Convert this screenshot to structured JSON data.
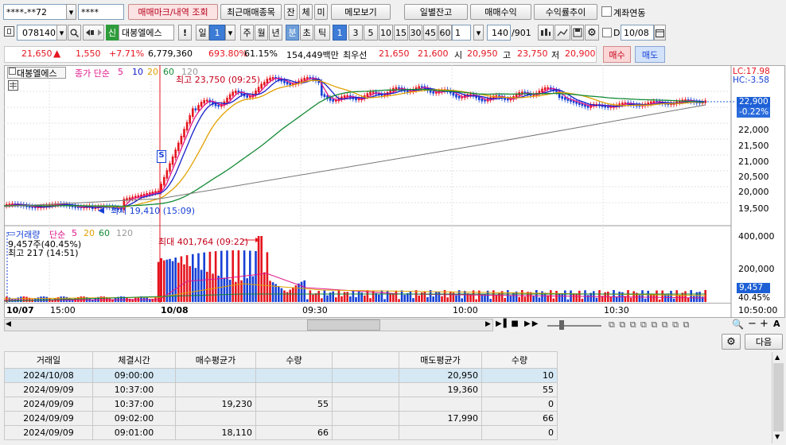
{
  "toolbar1": {
    "account": "****-**72",
    "password": "****",
    "btn_markview": "매매마크/내역 조회",
    "btn_recent": "최근매매종목",
    "btn_jan": "잔",
    "btn_che": "체",
    "btn_mi": "미",
    "btn_memo": "메모보기",
    "btn_daily": "일별잔고",
    "btn_profit": "매매수익",
    "btn_rate": "수익률추이",
    "chk_link": "계좌연동"
  },
  "toolbar2": {
    "code": "078140",
    "sin": "신",
    "stock_name": "대봉엘에스",
    "excl": "!",
    "period_il": "일",
    "period_num": "1",
    "p_ju": "주",
    "p_wol": "월",
    "p_nyeon": "년",
    "p_bun": "분",
    "p_cho": "초",
    "p_tik": "틱",
    "intervals": [
      "1",
      "3",
      "5",
      "10",
      "15",
      "30",
      "45",
      "60"
    ],
    "interval_sel": "1",
    "count": "140",
    "total": "/901",
    "d_label": "D",
    "date": "10/08"
  },
  "quote": {
    "price": "21,650",
    "arrow": "▲",
    "change": "1,550",
    "rate": "+7.71%",
    "volume": "6,779,360",
    "vol_rate": "693.80%",
    "turnover": "61.15%",
    "amount": "154,449백만",
    "best_label": "최우선",
    "best_ask": "21,650",
    "best_bid": "21,600",
    "open_label": "시",
    "open": "20,950",
    "high_label": "고",
    "high": "23,750",
    "low_label": "저",
    "low": "20,900",
    "buy": "매수",
    "sell": "매도"
  },
  "price_chart": {
    "name": "대봉엘에스",
    "ma_label": "종가 단순",
    "ma_periods": [
      "5",
      "10",
      "20",
      "60",
      "120"
    ],
    "ma_colors": [
      "#e0178a",
      "#1520c8",
      "#e2a100",
      "#138a35",
      "#777777"
    ],
    "high_marker": "최고 23,750 (09:25)",
    "low_marker": "최저 19,410 (15:09)",
    "lc": "LC:17.98",
    "hc": "HC:-3.58",
    "cur_price": "22,900",
    "cur_rate": "-0.22%",
    "y_ticks": [
      "22,000",
      "21,500",
      "21,000",
      "20,500",
      "20,000",
      "19,500"
    ],
    "s_badge": "S"
  },
  "volume_chart": {
    "name": "거래량",
    "ma_label": "단순",
    "ma_periods": [
      "5",
      "20",
      "60",
      "120"
    ],
    "max_marker": "최대 401,764 (09:22)",
    "info1": "9,457주(40.45%)",
    "info2": "최고 217 (14:51)",
    "y_ticks": [
      "400,000",
      "200,000"
    ],
    "cur_vol": "9,457",
    "cur_rate": "40.45%"
  },
  "x_axis": {
    "labels": [
      "10/07",
      "15:00",
      "10/08",
      "09:30",
      "10:00",
      "10:30",
      "10:50:00"
    ]
  },
  "table": {
    "headers": [
      "거래일",
      "체결시간",
      "매수평균가",
      "수량",
      "",
      "매도평균가",
      "수량"
    ],
    "rows": [
      [
        "2024/10/08",
        "09:00:00",
        "",
        "",
        "",
        "20,950",
        "10"
      ],
      [
        "2024/09/09",
        "10:37:00",
        "",
        "",
        "",
        "19,360",
        "55"
      ],
      [
        "2024/09/09",
        "10:37:00",
        "19,230",
        "55",
        "",
        "",
        "0"
      ],
      [
        "2024/09/09",
        "09:02:00",
        "",
        "",
        "",
        "17,990",
        "66"
      ],
      [
        "2024/09/09",
        "09:01:00",
        "18,110",
        "66",
        "",
        "",
        "0"
      ]
    ],
    "next_btn": "다음"
  }
}
